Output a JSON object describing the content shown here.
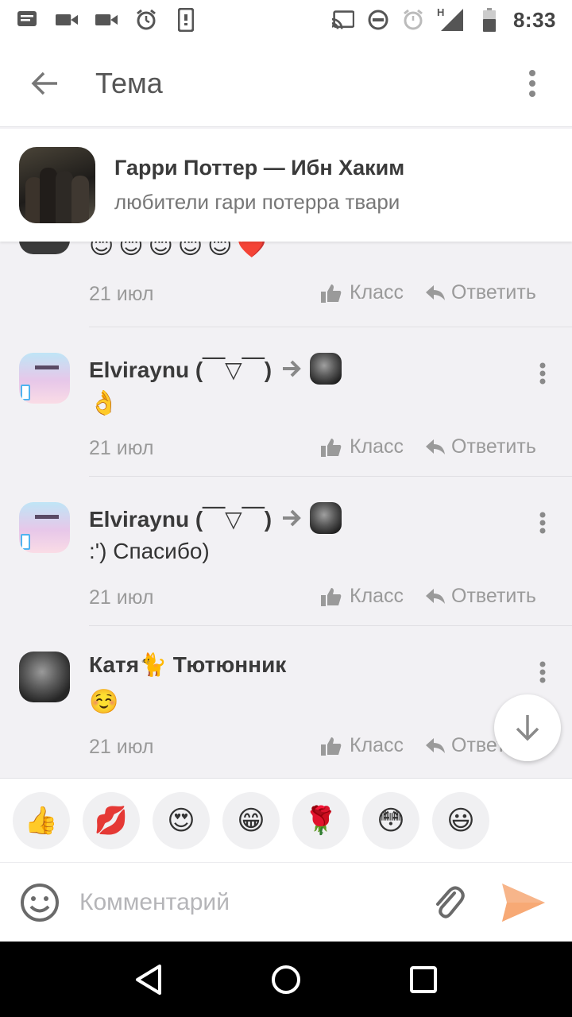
{
  "status_bar": {
    "time": "8:33",
    "network_label": "H",
    "left_icons": [
      "message-icon",
      "video-camera-icon",
      "video-camera-icon",
      "alarm-icon",
      "phone-icon"
    ],
    "right_icons": [
      "cast-icon",
      "do-not-disturb-icon",
      "alarm-icon",
      "signal-icon",
      "battery-icon"
    ]
  },
  "app_bar": {
    "title": "Тема"
  },
  "topic": {
    "title": "Гарри Поттер — Ибн Хаким",
    "subtitle": "любители гари потерра твари"
  },
  "first_comment_tail": {
    "emojis": [
      "😊",
      "😊",
      "😊",
      "😊",
      "😊",
      "❤️"
    ],
    "date": "21 июл",
    "like_label": "Класс",
    "reply_label": "Ответить"
  },
  "comments": [
    {
      "author": "Elviraynu (￣▽￣)",
      "text": "👌",
      "date": "21 июл",
      "like_label": "Класс",
      "reply_label": "Ответить"
    },
    {
      "author": "Elviraynu (￣▽￣)",
      "text": ":') Спасибо)",
      "date": "21 июл",
      "like_label": "Класс",
      "reply_label": "Ответить"
    },
    {
      "author": "Катя🐈 Тютюнник",
      "text": "☺️",
      "date": "21 июл",
      "like_label": "Класс",
      "reply_label": "Ответить"
    }
  ],
  "stickers": [
    "👍",
    "💋",
    "😍",
    "😁",
    "🌹",
    "😳",
    "😃"
  ],
  "composer": {
    "placeholder": "Комментарий"
  },
  "colors": {
    "accent_orange": "#f7a975",
    "muted_gray": "#9a9a9a",
    "background": "#f2f1f4"
  }
}
